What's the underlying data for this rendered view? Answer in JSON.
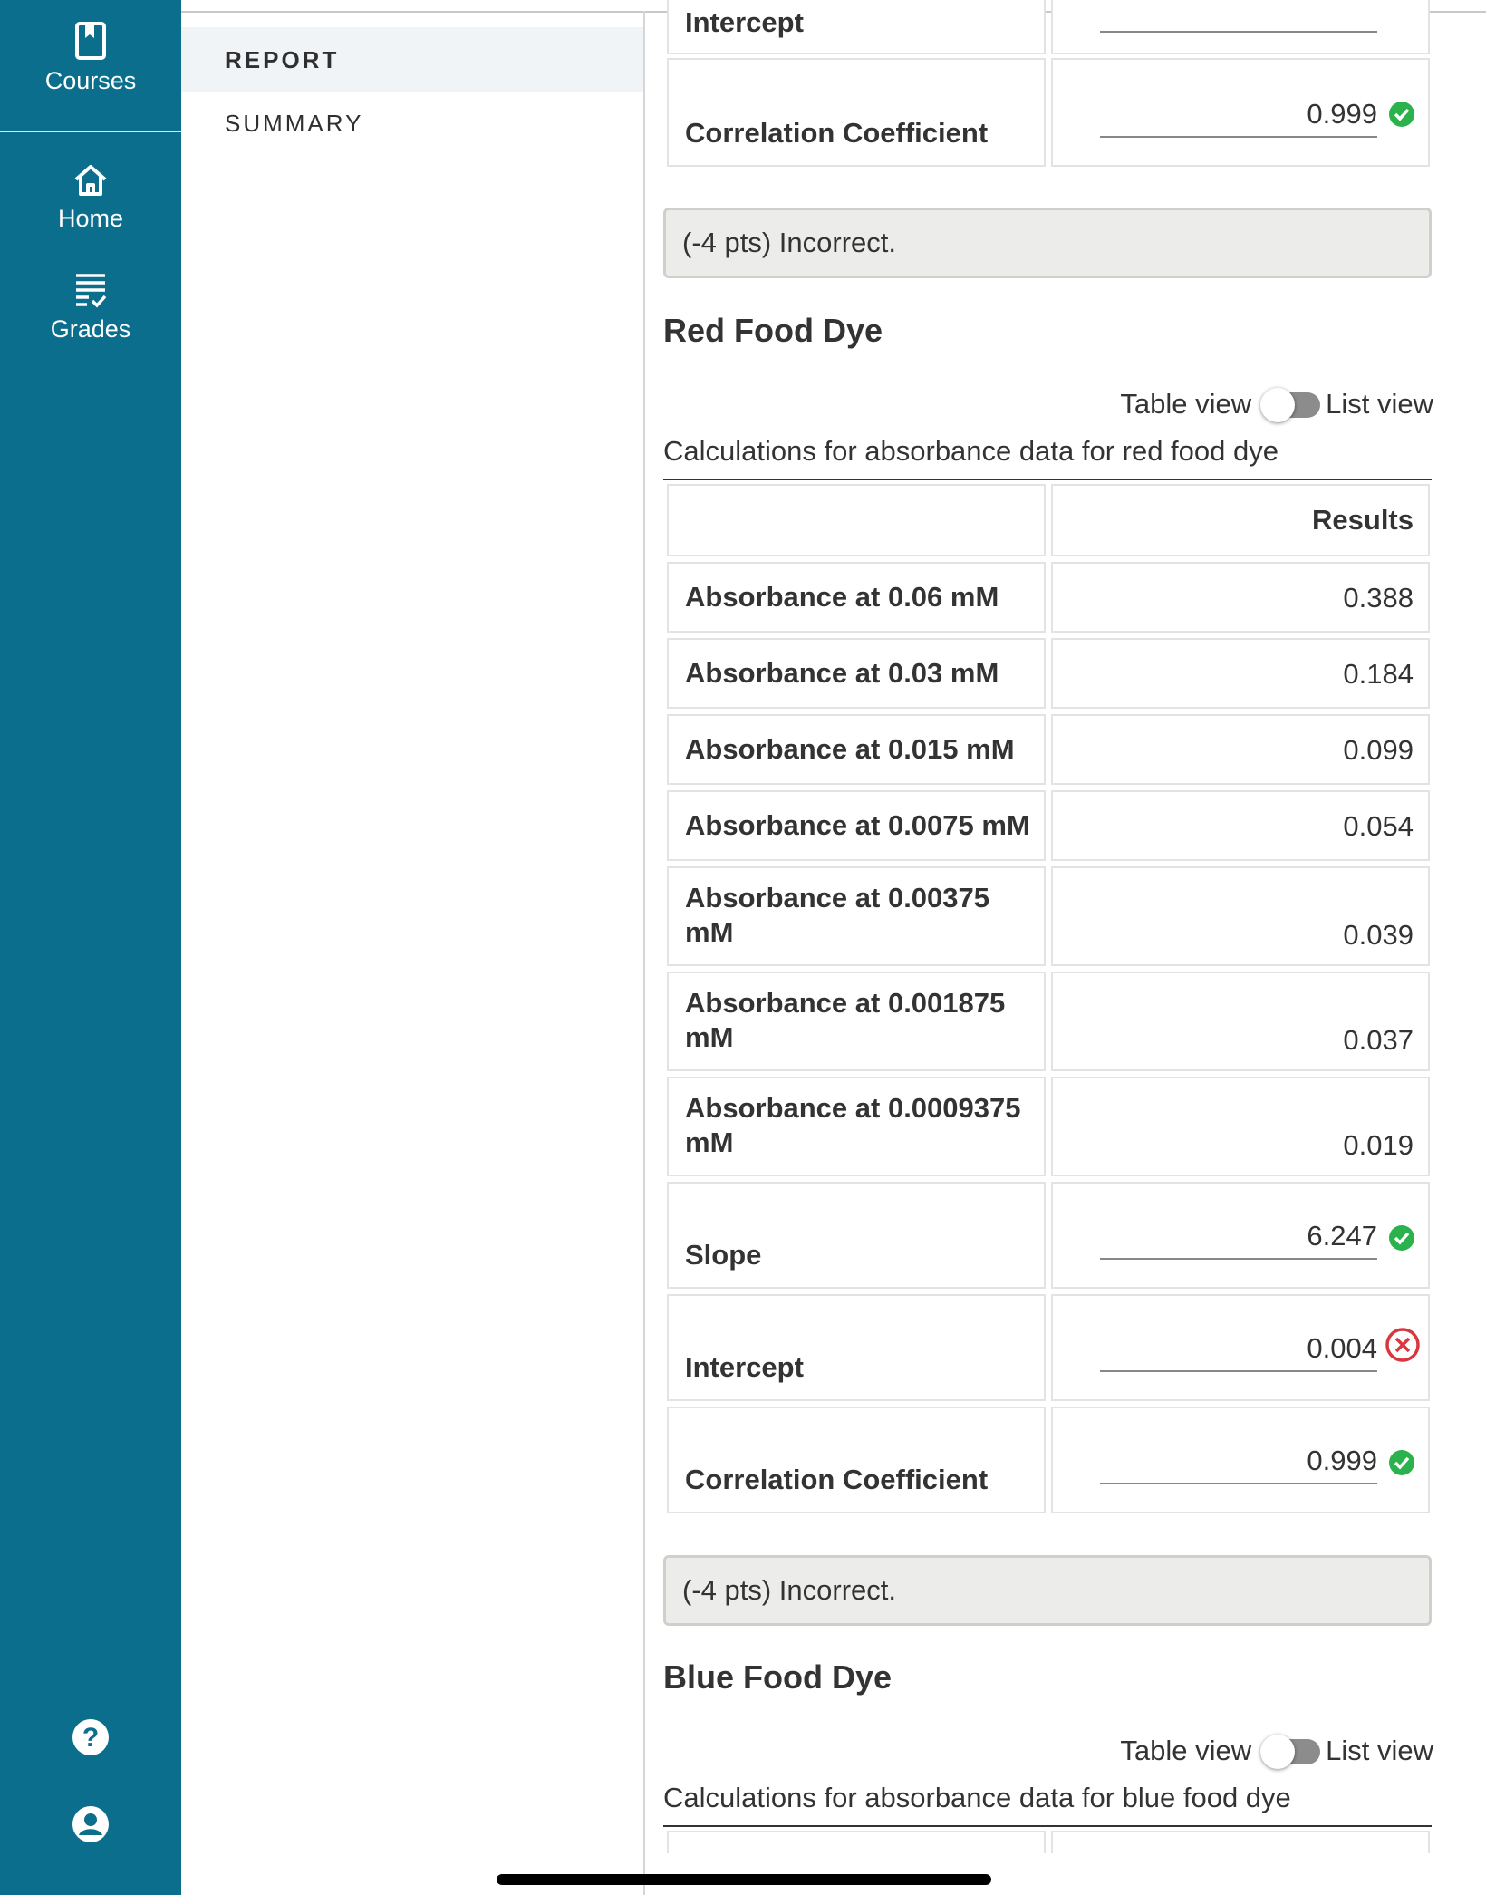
{
  "sidebar": {
    "courses_label": "Courses",
    "home_label": "Home",
    "grades_label": "Grades",
    "help_icon": "help-circle-icon",
    "account_icon": "account-circle-icon",
    "color": "#0a6e8c"
  },
  "subnav": {
    "report_label": "REPORT",
    "summary_label": "SUMMARY"
  },
  "previous_section": {
    "intercept_label": "Intercept",
    "corr_label": "Correlation Coefficient",
    "corr_value": "0.999",
    "feedback": "(-4 pts) Incorrect."
  },
  "red_section": {
    "title": "Red Food Dye",
    "table_view_label": "Table view",
    "list_view_label": "List view",
    "caption": "Calculations for absorbance data for red food dye",
    "results_header": "Results",
    "rows": [
      {
        "label": "Absorbance at 0.06 mM",
        "value": "0.388"
      },
      {
        "label": "Absorbance at 0.03 mM",
        "value": "0.184"
      },
      {
        "label": "Absorbance at 0.015 mM",
        "value": "0.099"
      },
      {
        "label": "Absorbance at 0.0075 mM",
        "value": "0.054"
      },
      {
        "label": "Absorbance at 0.00375 mM",
        "value": "0.039"
      },
      {
        "label": "Absorbance at 0.001875 mM",
        "value": "0.037"
      },
      {
        "label": "Absorbance at 0.0009375 mM",
        "value": "0.019"
      }
    ],
    "slope_label": "Slope",
    "slope_value": "6.247",
    "intercept_label": "Intercept",
    "intercept_value": "0.004",
    "corr_label": "Correlation Coefficient",
    "corr_value": "0.999",
    "feedback": "(-4 pts) Incorrect."
  },
  "blue_section": {
    "title": "Blue Food Dye",
    "table_view_label": "Table view",
    "list_view_label": "List view",
    "caption": "Calculations for absorbance data for blue food dye"
  },
  "colors": {
    "correct": "#2bb24c",
    "incorrect": "#d9363e"
  }
}
